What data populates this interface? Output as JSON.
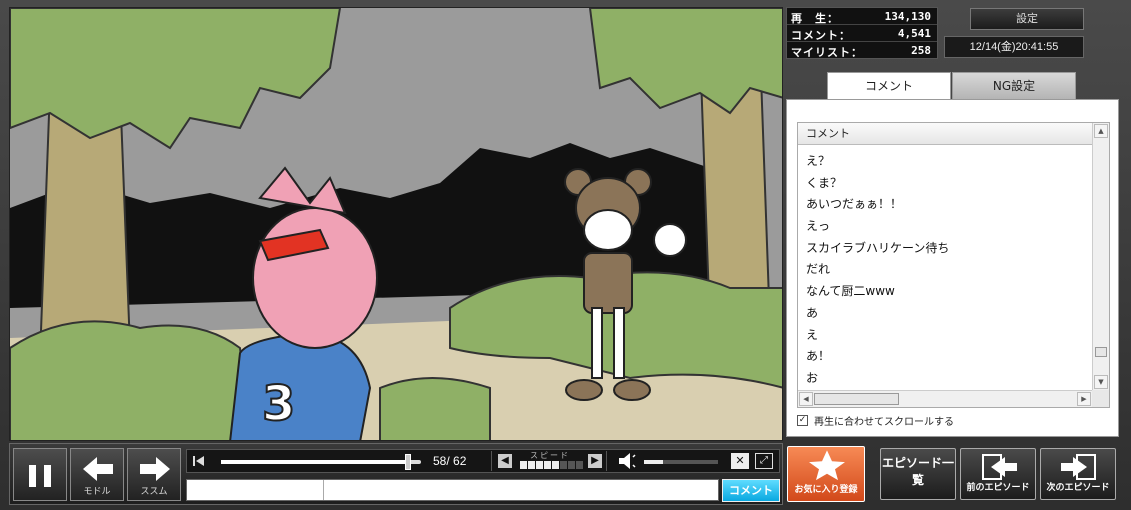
{
  "stats": {
    "play_label": "再　生：",
    "play_count": "134,130",
    "comment_label": "コメント：",
    "comment_count": "4,541",
    "mylist_label": "マイリスト：",
    "mylist_count": "258"
  },
  "header": {
    "settings_label": "設定",
    "datetime": "12/14(金)20:41:55"
  },
  "tabs": [
    {
      "label": "コメント",
      "active": true
    },
    {
      "label": "NG設定",
      "active": false
    }
  ],
  "comment_panel": {
    "header": "コメント",
    "comments": [
      "え？",
      "くま？",
      "あいつだぁぁ！！",
      "えっ",
      "スカイラブハリケーン待ち",
      "だれ",
      "なんて厨二www",
      "あ",
      "え",
      "あ！",
      "お"
    ],
    "autoscroll_label": "再生に合わせてスクロールする",
    "autoscroll_checked": true
  },
  "player": {
    "back_label": "モドル",
    "forward_label": "ススム",
    "time_readout": "58/ 62",
    "current_seconds": 58,
    "total_seconds": 62,
    "speed_label": "スピード",
    "speed_level": 5,
    "speed_max": 8,
    "volume_fraction": 0.25,
    "submit_label": "コメント"
  },
  "actions": {
    "favorite_label": "お気に入り登録",
    "episode_list_label": "エピソード一覧",
    "prev_episode_label": "前のエピソード",
    "next_episode_label": "次のエピソード"
  },
  "colors": {
    "submit_accent": "#0aa8e0",
    "favorite_accent": "#d2491a"
  },
  "icons": {
    "pause": "pause-icon",
    "back": "arrow-left-icon",
    "forward": "arrow-right-icon",
    "favorite": "star-icon",
    "prev_episode": "prev-episode-icon",
    "next_episode": "next-episode-icon"
  }
}
